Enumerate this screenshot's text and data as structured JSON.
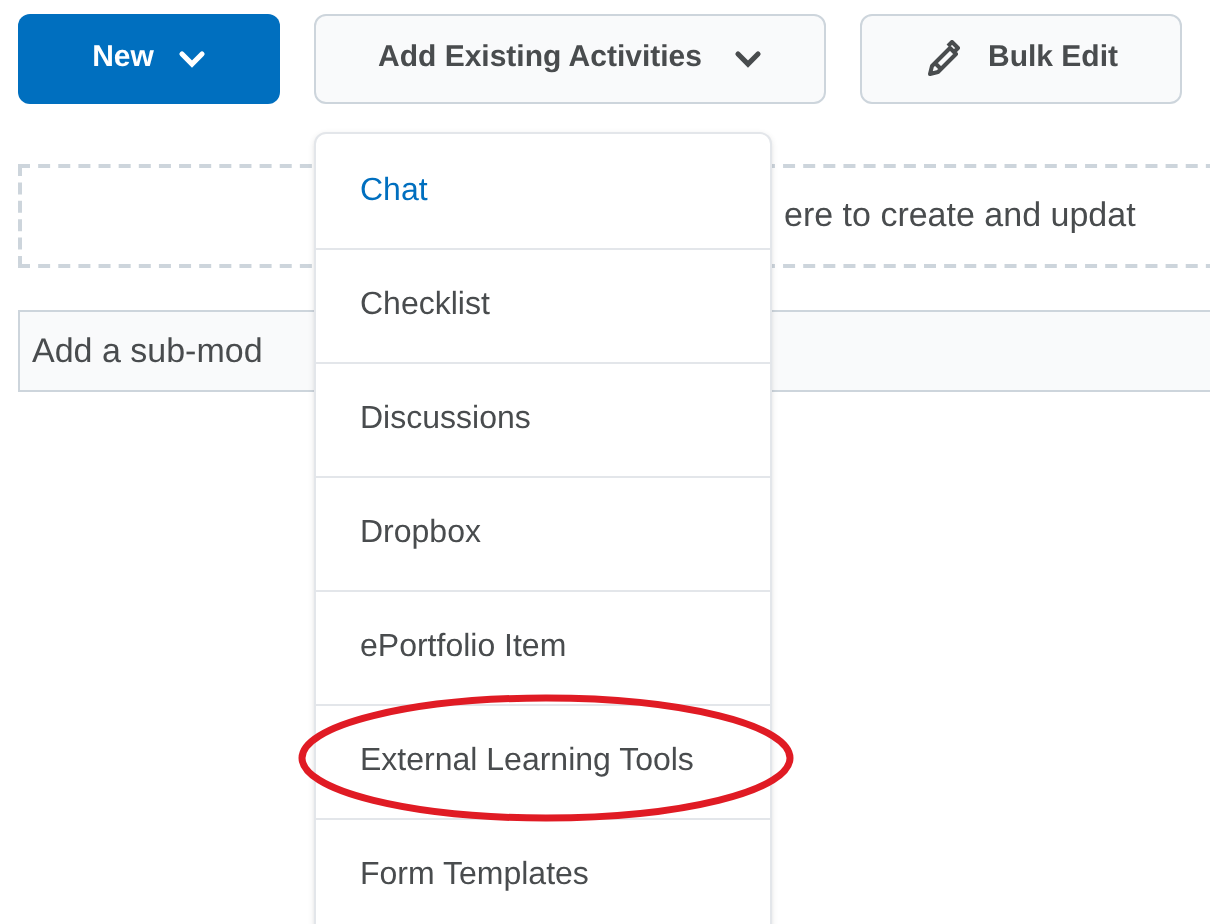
{
  "toolbar": {
    "new_button": {
      "label": "New"
    },
    "add_existing_button": {
      "label": "Add Existing Activities"
    },
    "bulk_edit_button": {
      "label": "Bulk Edit"
    }
  },
  "drop_zone": {
    "text": "ere to create and updat"
  },
  "sub_module_field": {
    "placeholder": "Add a sub-mod"
  },
  "menu": {
    "items": [
      {
        "label": "Chat",
        "selected": true,
        "circled": false
      },
      {
        "label": "Checklist",
        "selected": false,
        "circled": false
      },
      {
        "label": "Discussions",
        "selected": false,
        "circled": false
      },
      {
        "label": "Dropbox",
        "selected": false,
        "circled": false
      },
      {
        "label": "ePortfolio Item",
        "selected": false,
        "circled": false
      },
      {
        "label": "External Learning Tools",
        "selected": false,
        "circled": true
      },
      {
        "label": "Form Templates",
        "selected": false,
        "circled": false
      }
    ]
  }
}
